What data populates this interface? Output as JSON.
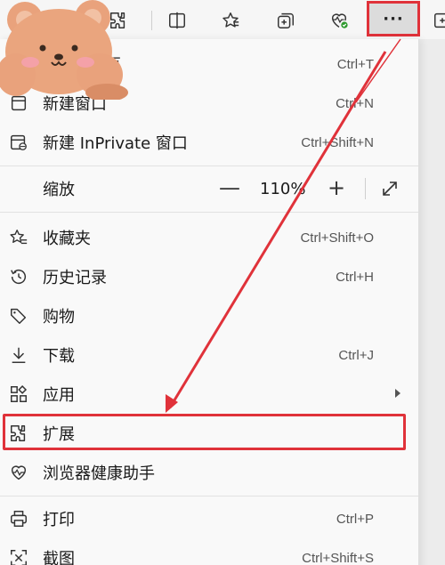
{
  "toolbar": {
    "more_label": "···",
    "icons": [
      "extensions-icon",
      "split-screen-icon",
      "favorites-icon",
      "collections-icon",
      "browser-essentials-icon",
      "more-icon",
      "new-window-icon"
    ]
  },
  "menu": {
    "items": [
      {
        "label": "页",
        "shortcut": "Ctrl+T",
        "icon": "new-tab-icon"
      },
      {
        "label": "新建窗口",
        "shortcut": "Ctrl+N",
        "icon": "new-window-icon"
      },
      {
        "label": "新建 InPrivate 窗口",
        "shortcut": "Ctrl+Shift+N",
        "icon": "inprivate-icon"
      },
      {
        "label": "缩放",
        "icon": "zoom-icon"
      },
      {
        "label": "收藏夹",
        "shortcut": "Ctrl+Shift+O",
        "icon": "favorites-icon"
      },
      {
        "label": "历史记录",
        "shortcut": "Ctrl+H",
        "icon": "history-icon"
      },
      {
        "label": "购物",
        "icon": "shopping-icon"
      },
      {
        "label": "下载",
        "shortcut": "Ctrl+J",
        "icon": "download-icon"
      },
      {
        "label": "应用",
        "icon": "apps-icon"
      },
      {
        "label": "扩展",
        "icon": "extensions-icon"
      },
      {
        "label": "浏览器健康助手",
        "icon": "browser-health-icon"
      },
      {
        "label": "打印",
        "shortcut": "Ctrl+P",
        "icon": "print-icon"
      },
      {
        "label": "截图",
        "shortcut": "Ctrl+Shift+S",
        "icon": "screenshot-icon"
      }
    ],
    "zoom": {
      "minus": "—",
      "value": "110%",
      "plus": "+"
    }
  },
  "colors": {
    "highlight": "#e0323a",
    "menu_bg": "#f9f9f9",
    "toolbar_bg": "#f6f6f6"
  }
}
